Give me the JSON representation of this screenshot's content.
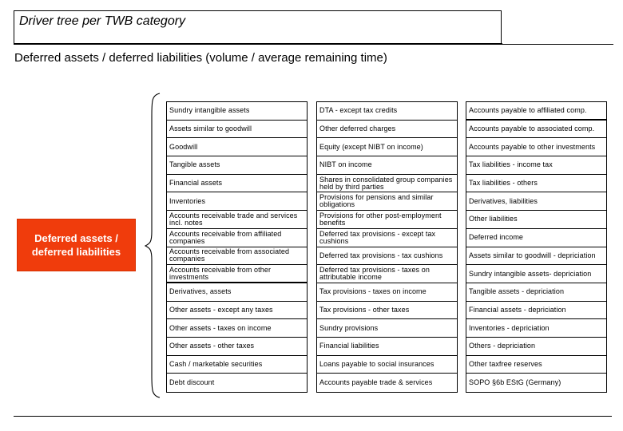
{
  "header": {
    "title": "Driver tree per TWB category",
    "subtitle": "Deferred assets / deferred liabilities (volume / average remaining time)"
  },
  "root_node": {
    "label": "Deferred assets / deferred liabilities",
    "color": "#f03c0c"
  },
  "columns": [
    {
      "items": [
        "Sundry intangible assets",
        "Assets similar to goodwill",
        "Goodwill",
        "Tangible assets",
        "Financial assets",
        "Inventories",
        "Accounts receivable trade and services incl. notes",
        "Accounts receivable from affiliated companies",
        "Accounts receivable from associated companies",
        "Accounts receivable from other investments",
        "Derivatives, assets",
        "Other assets - except any taxes",
        "Other assets - taxes on income",
        "Other assets - other taxes",
        "Cash / marketable securities",
        "Debt discount"
      ]
    },
    {
      "items": [
        "DTA - except tax credits",
        "Other deferred charges",
        "Equity (except NIBT on income)",
        "NIBT on income",
        "Shares in consolidated group companies held by third parties",
        "Provisions for pensions and similar obligations",
        "Provisions for other post-employment benefits",
        "Deferred tax provisions - except tax cushions",
        "Deferred tax provisions - tax cushions",
        "Deferred tax provisions - taxes on attributable income",
        "Tax provisions - taxes on income",
        "Tax provisions - other taxes",
        "Sundry provisions",
        "Financial liabilities",
        "Loans payable to social insurances",
        "Accounts payable trade & services"
      ]
    },
    {
      "items": [
        "Accounts payable to affiliated comp.",
        "Accounts payable to associated comp.",
        "Accounts payable to other investments",
        "Tax liabilities - income tax",
        "Tax liabilities - others",
        "Derivatives, liabilities",
        "Other liabilities",
        "Deferred income",
        "Assets similar to goodwill - depriciation",
        "Sundry intangible assets- depriciation",
        "Tangible assets - depriciation",
        "Financial assets - depriciation",
        "Inventories - depriciation",
        "Others - depriciation",
        "Other taxfree reserves",
        "SOPO §6b EStG (Germany)"
      ]
    }
  ]
}
